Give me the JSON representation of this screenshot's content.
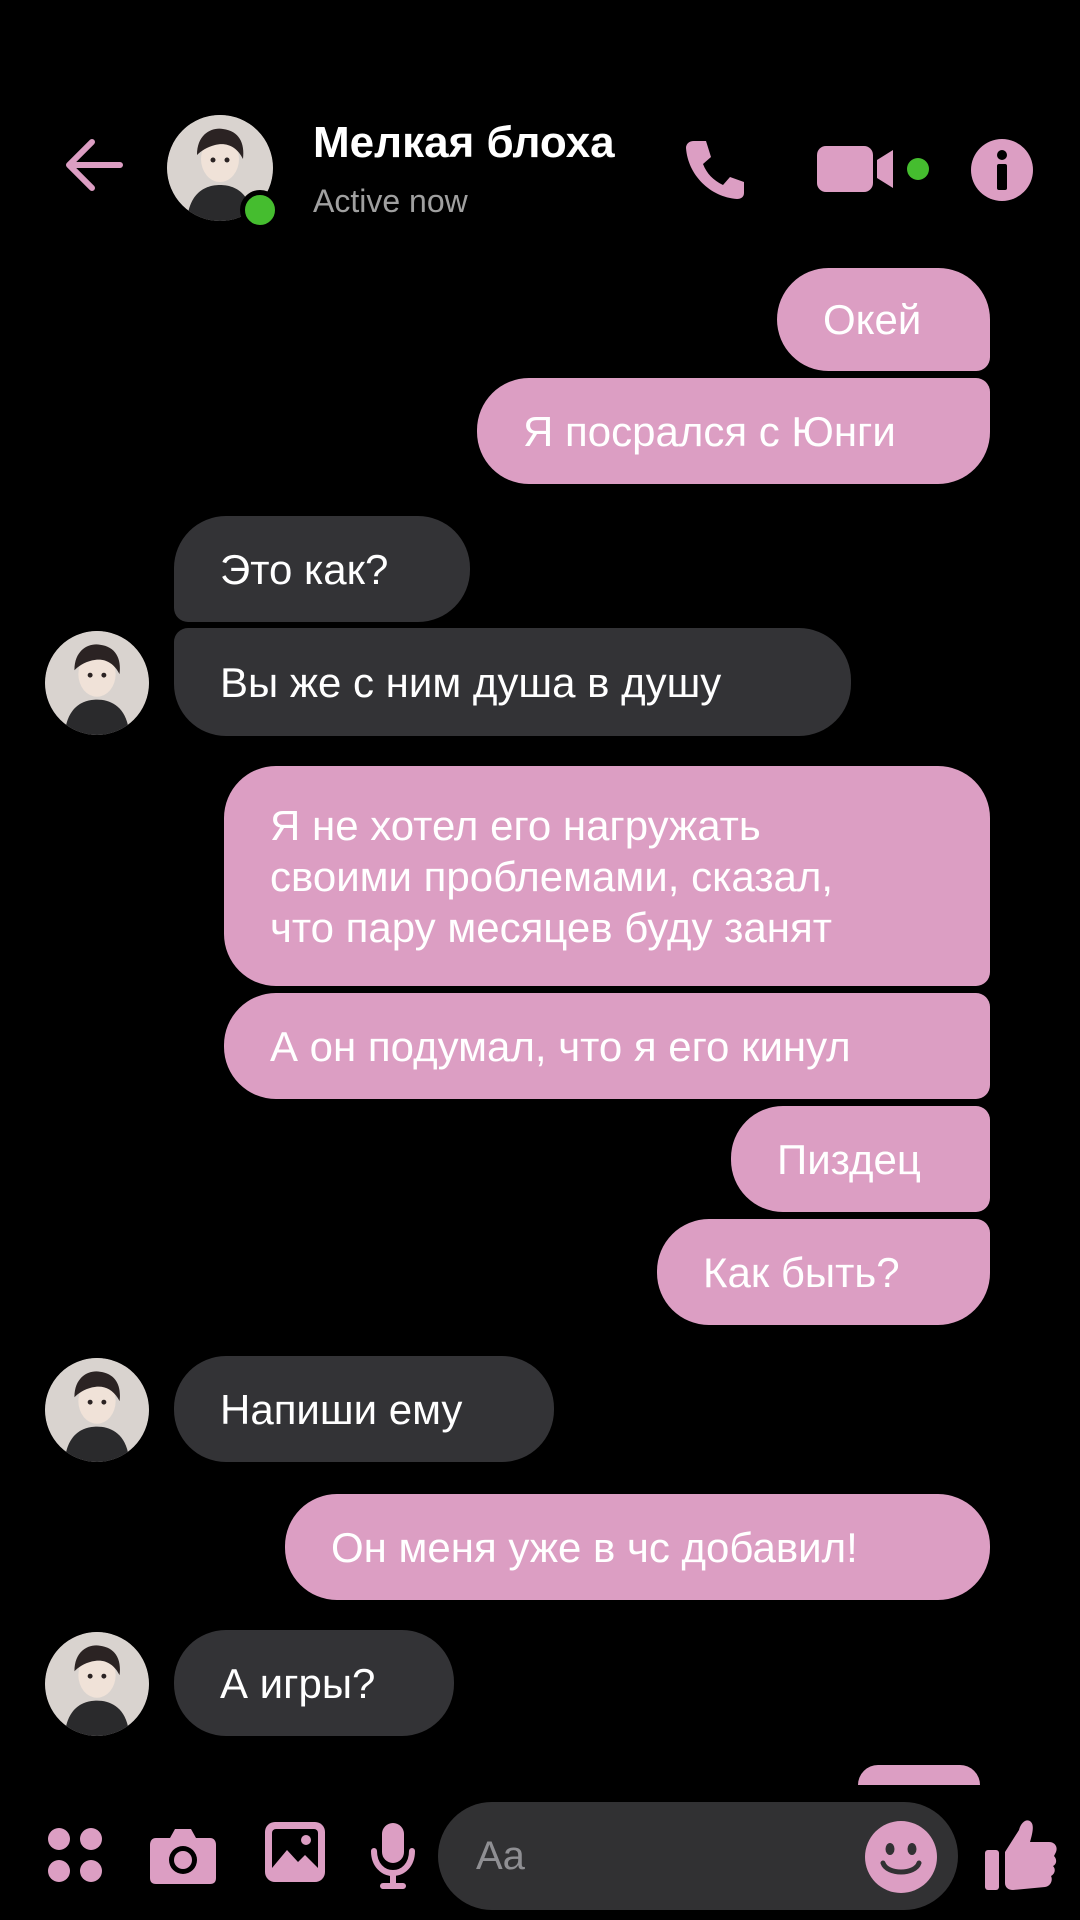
{
  "header": {
    "contact_name": "Мелкая блоха",
    "status": "Active now"
  },
  "colors": {
    "accent": "#dc9ec3",
    "incoming_bubble": "#333336",
    "background": "#000000",
    "presence": "#45bd2f"
  },
  "icons": {
    "back": "arrow-left-icon",
    "call": "phone-icon",
    "video": "video-camera-icon",
    "info": "info-icon",
    "apps": "four-dots-icon",
    "camera": "camera-icon",
    "gallery": "image-icon",
    "mic": "microphone-icon",
    "emoji": "smiley-icon",
    "like": "thumbs-up-icon"
  },
  "messages": [
    {
      "from": "me",
      "text": "Окей"
    },
    {
      "from": "me",
      "text": "Я посрался с Юнги"
    },
    {
      "from": "them",
      "text": "Это как?"
    },
    {
      "from": "them",
      "text": "Вы же с ним душа в душу"
    },
    {
      "from": "me",
      "text": "Я не хотел его нагружать\nсвоими проблемами, сказал,\nчто пару месяцев буду занят"
    },
    {
      "from": "me",
      "text": "А он подумал, что я его кинул"
    },
    {
      "from": "me",
      "text": "Пиздец"
    },
    {
      "from": "me",
      "text": "Как быть?"
    },
    {
      "from": "them",
      "text": "Напиши ему"
    },
    {
      "from": "me",
      "text": "Он меня уже в чс добавил!"
    },
    {
      "from": "them",
      "text": "А игры?"
    }
  ],
  "composer": {
    "placeholder": "Aa"
  }
}
